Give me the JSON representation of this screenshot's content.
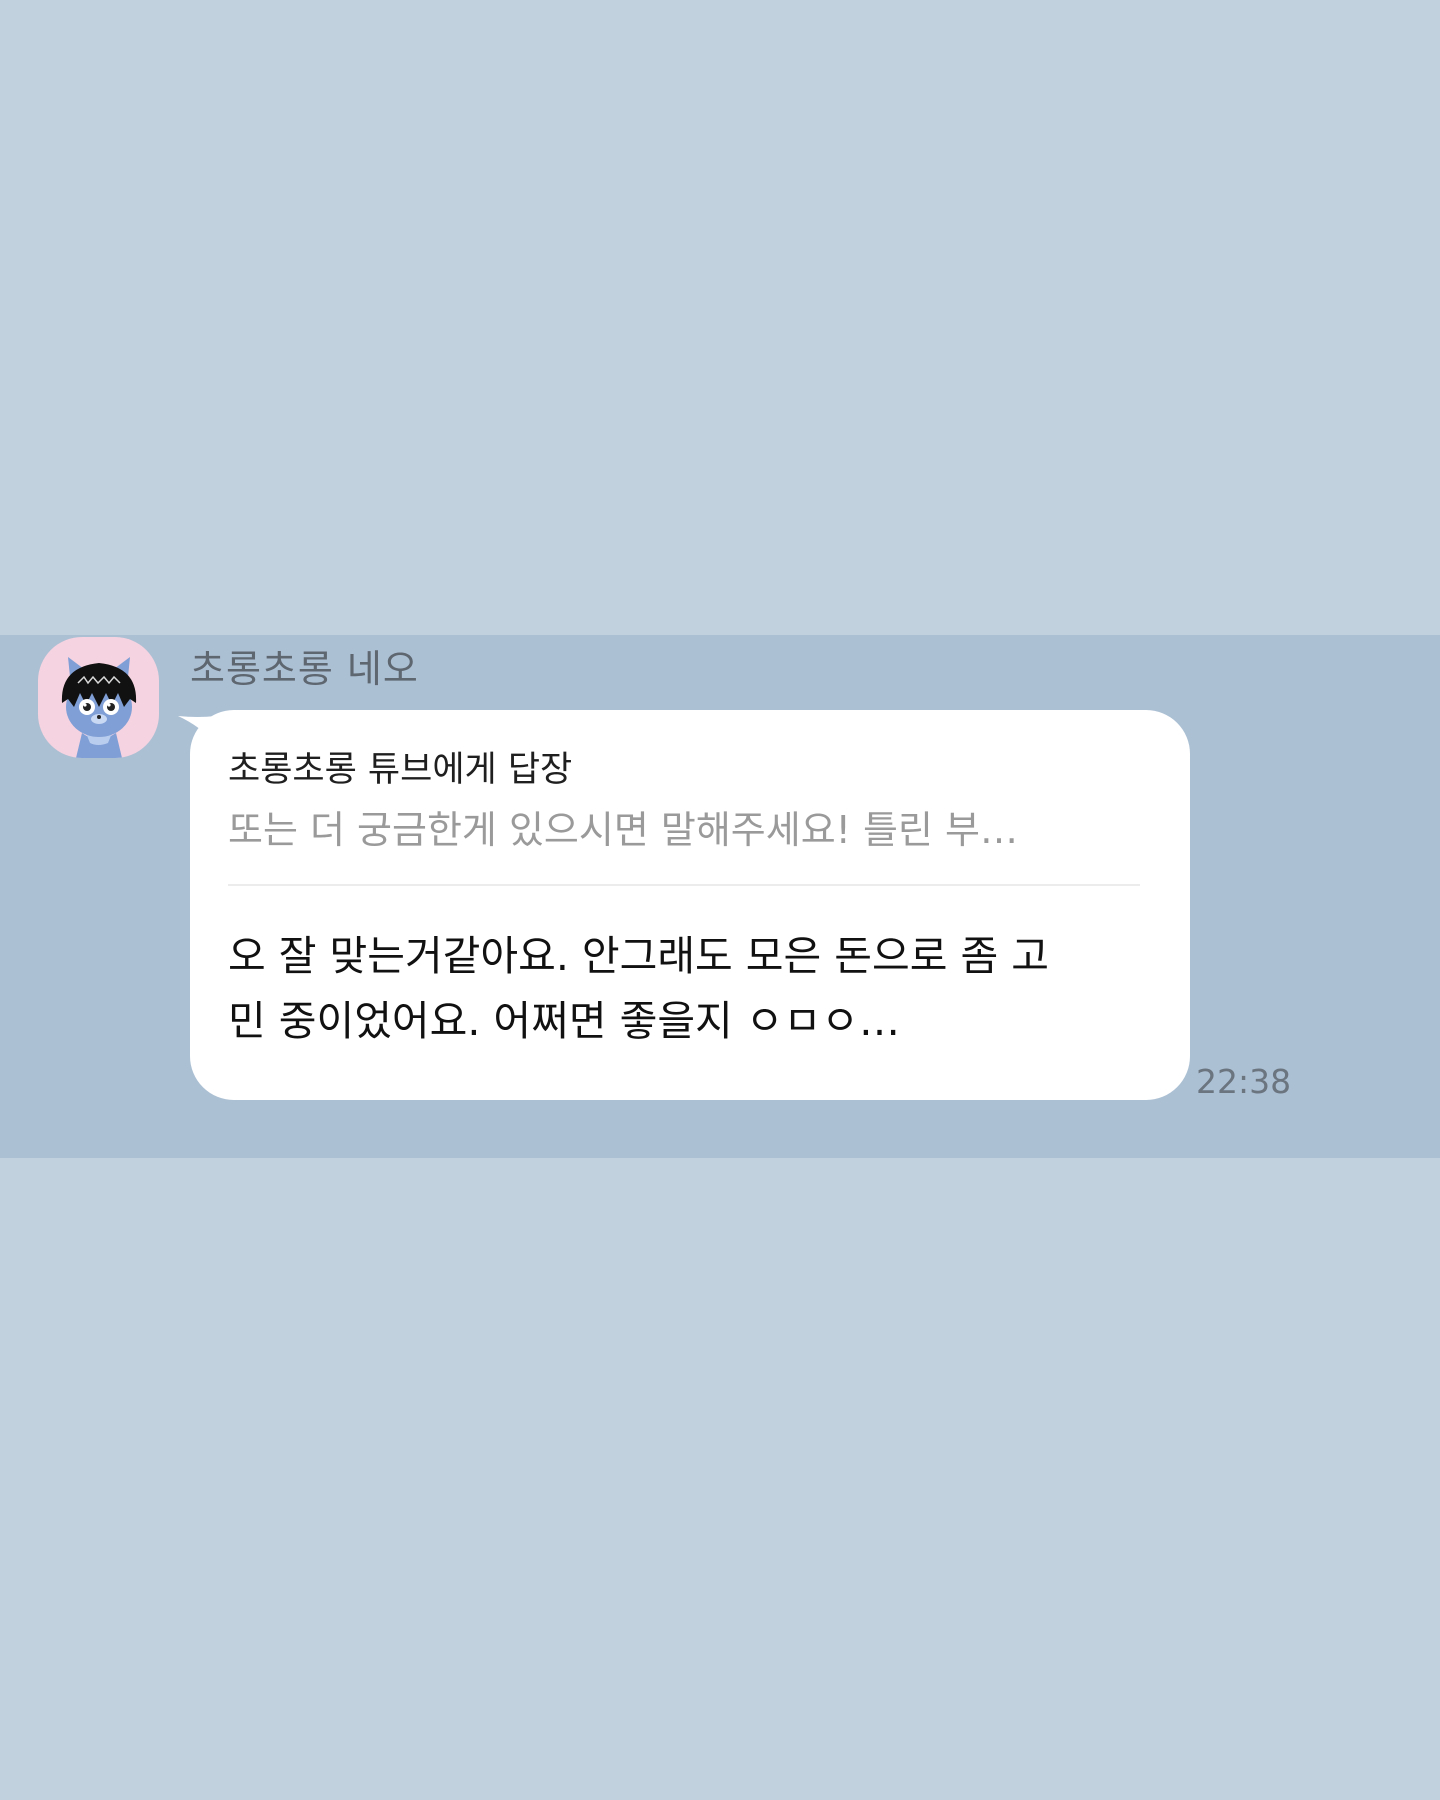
{
  "chat": {
    "sender_name": "초롱초롱 네오",
    "reply": {
      "title": "초롱초롱 튜브에게 답장",
      "preview": "또는 더 궁금한게 있으시면 말해주세요! 틀린 부…"
    },
    "message": "오 잘 맞는거같아요. 안그래도 모은 돈으로 좀 고\n민 중이었어요. 어쩌면 좋을지 ㅇㅁㅇ…",
    "time": "22:38",
    "avatar_icon": "neo-cat-avatar-icon"
  },
  "colors": {
    "background": "#c2d1de",
    "highlight": "#acc0d4",
    "bubble": "#ffffff",
    "avatar_bg": "#f6d3e0"
  }
}
